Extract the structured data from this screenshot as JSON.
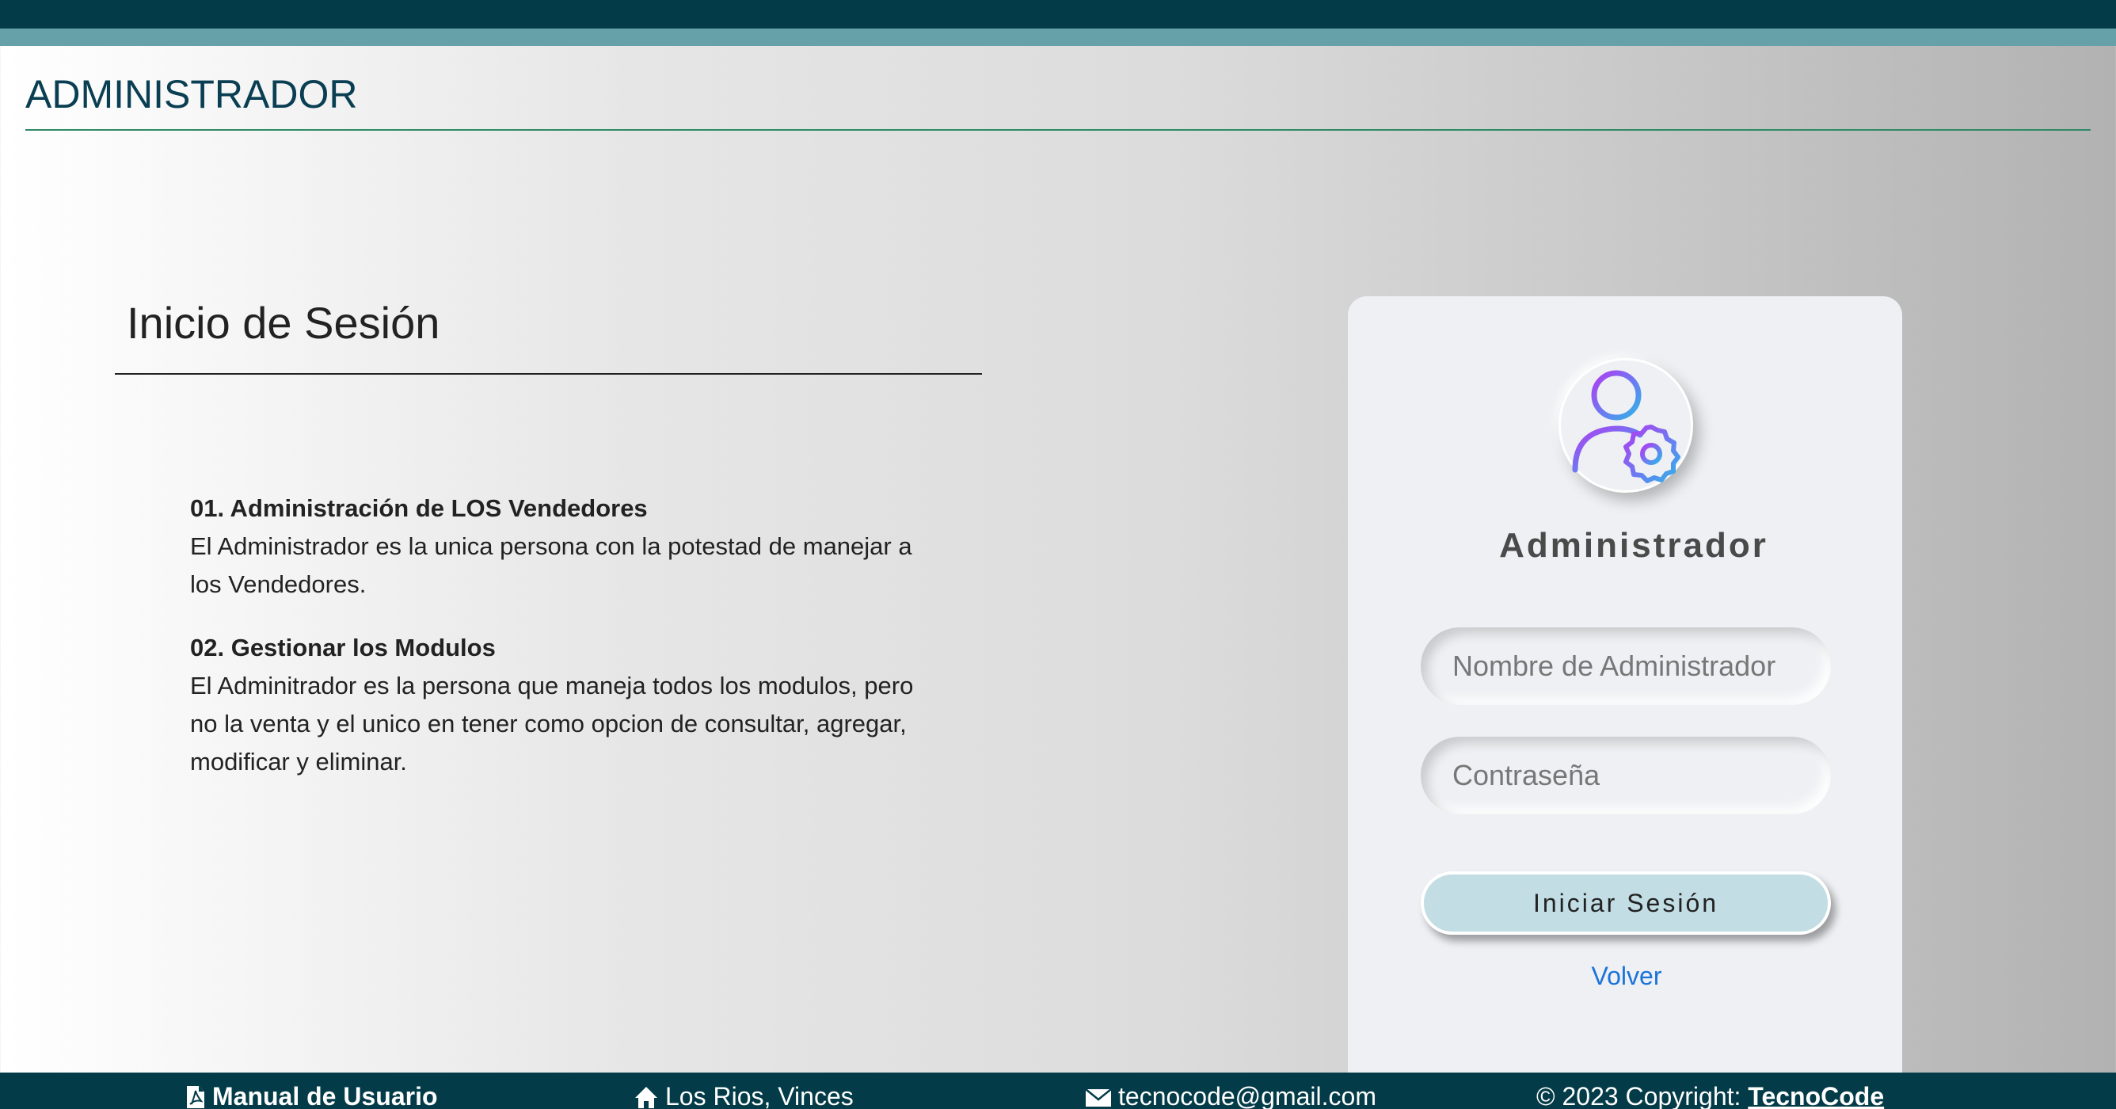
{
  "header": {
    "title": "",
    "section_title": "ADMINISTRADOR"
  },
  "intro": {
    "title": "Inicio de Sesión",
    "items": [
      {
        "heading": "01. Administración de LOS Vendedores",
        "text": "El Administrador es la unica persona con la potestad de manejar a los Vendedores."
      },
      {
        "heading": "02. Gestionar los Modulos",
        "text": "El Adminitrador es la persona que maneja todos los modulos, pero no la venta y el unico en tener como opcion de consultar, agregar, modificar y eliminar."
      }
    ]
  },
  "login": {
    "avatar_icon": "user-gear-icon",
    "title": "Administrador",
    "username_placeholder": "Nombre de Administrador",
    "password_placeholder": "Contraseña",
    "submit_label": "Iniciar Sesión",
    "back_label": "Volver"
  },
  "footer": {
    "manual": {
      "icon": "pdf-file-icon",
      "label": "Manual de Usuario"
    },
    "address": {
      "icon": "home-icon",
      "label": "Los Rios, Vinces"
    },
    "email": {
      "icon": "envelope-icon",
      "label": "tecnocode@gmail.com"
    },
    "copyright_prefix": "© 2023 Copyright: ",
    "copyright_brand": "TecnoCode"
  },
  "colors": {
    "header_bg": "#033c48",
    "header_stripe": "#66a1aa",
    "accent_rule": "#2e8a66",
    "card_bg": "#eef0f3",
    "button_bg": "#c2dde3",
    "link": "#1a73d9"
  }
}
